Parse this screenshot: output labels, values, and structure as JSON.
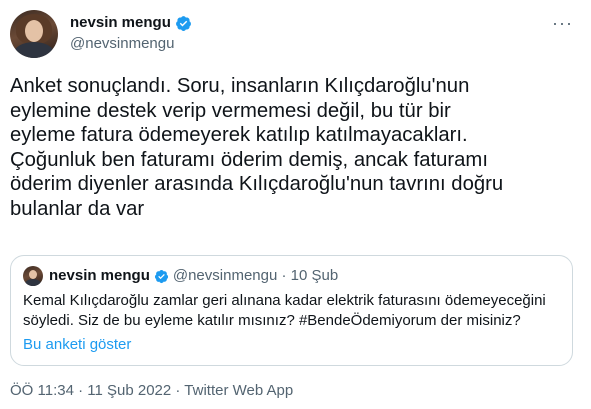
{
  "author": {
    "name": "nevsin mengu",
    "handle": "@nevsinmengu"
  },
  "more_label": "···",
  "tweet_text": "Anket sonuçlandı. Soru, insanların Kılıçdaroğlu'nun\neylemine destek verip vermemesi değil, bu tür bir\neyleme fatura ödemeyerek katılıp katılmayacakları.\nÇoğunluk ben faturamı öderim demiş, ancak faturamı\nöderim diyenler arasında Kılıçdaroğlu'nun tavrını doğru\nbulanlar da var",
  "quoted": {
    "name": "nevsin mengu",
    "handle_date": "@nevsinmengu · 10 Şub",
    "text": "Kemal Kılıçdaroğlu zamlar geri alınana kadar elektrik faturasını ödemeyeceğini\nsöyledi. Siz de bu eyleme katılır mısınız? #BendeÖdemiyorum der misiniz?",
    "poll_link": "Bu anketi göster"
  },
  "footer": {
    "timestamp": "ÖÖ 11:34 · 11 Şub 2022 · ",
    "source": "Twitter Web App"
  },
  "colors": {
    "accent": "#1d9bf0",
    "secondary_text": "#536471",
    "border": "#cfd9de"
  },
  "icons": [
    "verified-badge-icon",
    "more-options-icon"
  ]
}
